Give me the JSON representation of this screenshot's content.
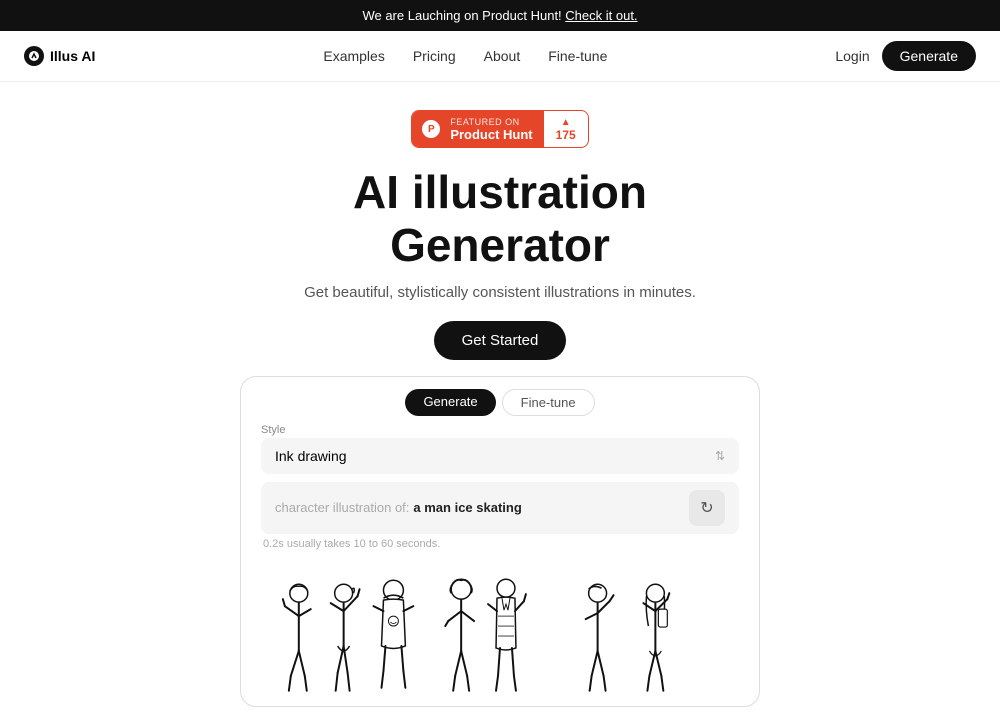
{
  "banner": {
    "text": "We are Lauching on Product Hunt! ",
    "link_text": "Check it out."
  },
  "nav": {
    "logo_text": "Illus AI",
    "links": [
      "Examples",
      "Pricing",
      "About",
      "Fine-tune"
    ],
    "login_label": "Login",
    "generate_label": "Generate"
  },
  "product_hunt": {
    "featured_text": "FEATURED ON",
    "name": "Product Hunt",
    "vote_count": "175"
  },
  "hero": {
    "title_line1": "AI illustration",
    "title_line2": "Generator",
    "subtitle": "Get beautiful, stylistically consistent illustrations in minutes.",
    "cta_label": "Get Started"
  },
  "demo": {
    "tab_generate": "Generate",
    "tab_finetune": "Fine-tune",
    "style_label": "Style",
    "style_value": "Ink drawing",
    "prompt_prefix": "character illustration of:",
    "prompt_text": "a man ice skating",
    "hint_text": "0.2s usually takes 10 to 60 seconds.",
    "gen_icon": "↻"
  }
}
